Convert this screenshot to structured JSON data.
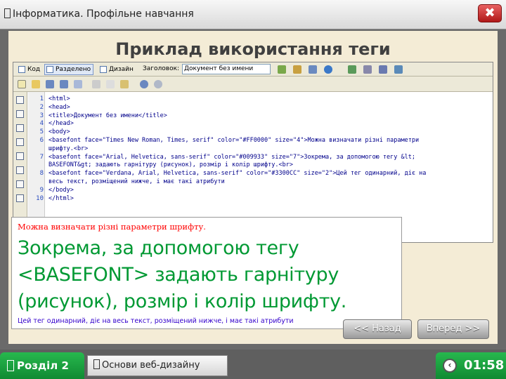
{
  "window": {
    "title": "Інформатика. Профільне навчання",
    "close_symbol": "✖"
  },
  "slide": {
    "heading": "Приклад використання теги"
  },
  "editor": {
    "toolbar": {
      "code_label": "Код",
      "split_label": "Разделено",
      "design_label": "Дизайн",
      "title_label": "Заголовок:",
      "title_value": "Документ без имени"
    },
    "lines": [
      {
        "n": "1",
        "text": "<html>"
      },
      {
        "n": "2",
        "text": "<head>"
      },
      {
        "n": "3",
        "text": "<title>Документ без имени</title>"
      },
      {
        "n": "4",
        "text": "</head>"
      },
      {
        "n": "5",
        "text": "<body>"
      },
      {
        "n": "6",
        "text": "<basefont face=\"Times New Roman, Times, serif\" color=\"#FF0000\" size=\"4\">Можна визначати різні параметри"
      },
      {
        "n": "",
        "text": "шрифту.<br>"
      },
      {
        "n": "7",
        "text": "<basefont face=\"Arial, Helvetica, sans-serif\" color=\"#009933\" size=\"7\">Зокрема, за допомогою тегу &lt;"
      },
      {
        "n": "",
        "text": "BASEFONT&gt; задають гарнітуру (рисунок), розмір і колір шрифту.<br>"
      },
      {
        "n": "8",
        "text": "<basefont face=\"Verdana, Arial, Helvetica, sans-serif\" color=\"#3300CC\" size=\"2\">Цей тег одинарний, діє на"
      },
      {
        "n": "",
        "text": "весь текст, розміщений нижче, і має такі атрибути"
      },
      {
        "n": "9",
        "text": "</body>"
      },
      {
        "n": "10",
        "text": "</html>"
      }
    ]
  },
  "preview": {
    "line1": "Можна визначати різні параметри шрифту.",
    "line2": "Зокрема, за допомогою тегу",
    "line3": "<BASEFONT> задають гарнітуру",
    "line4": "(рисунок), розмір і колір шрифту.",
    "line5": "Цей тег одинарний, діє на весь текст, розміщений нижче, і має такі атрибути"
  },
  "navigation": {
    "back_label": "<< Назад",
    "forward_label": "Вперед >>"
  },
  "footer": {
    "section_label": "Розділ 2",
    "course_label": "Основи веб-дизайну",
    "timer": "01:58"
  },
  "colors": {
    "heading": "#404040",
    "preview_red": "#FF0000",
    "preview_green": "#009933",
    "preview_blue": "#3300CC",
    "footer_green": "#1a9e3e"
  },
  "icons": [
    "window-icon",
    "close-icon",
    "section-icon",
    "course-icon",
    "timer-icon"
  ]
}
